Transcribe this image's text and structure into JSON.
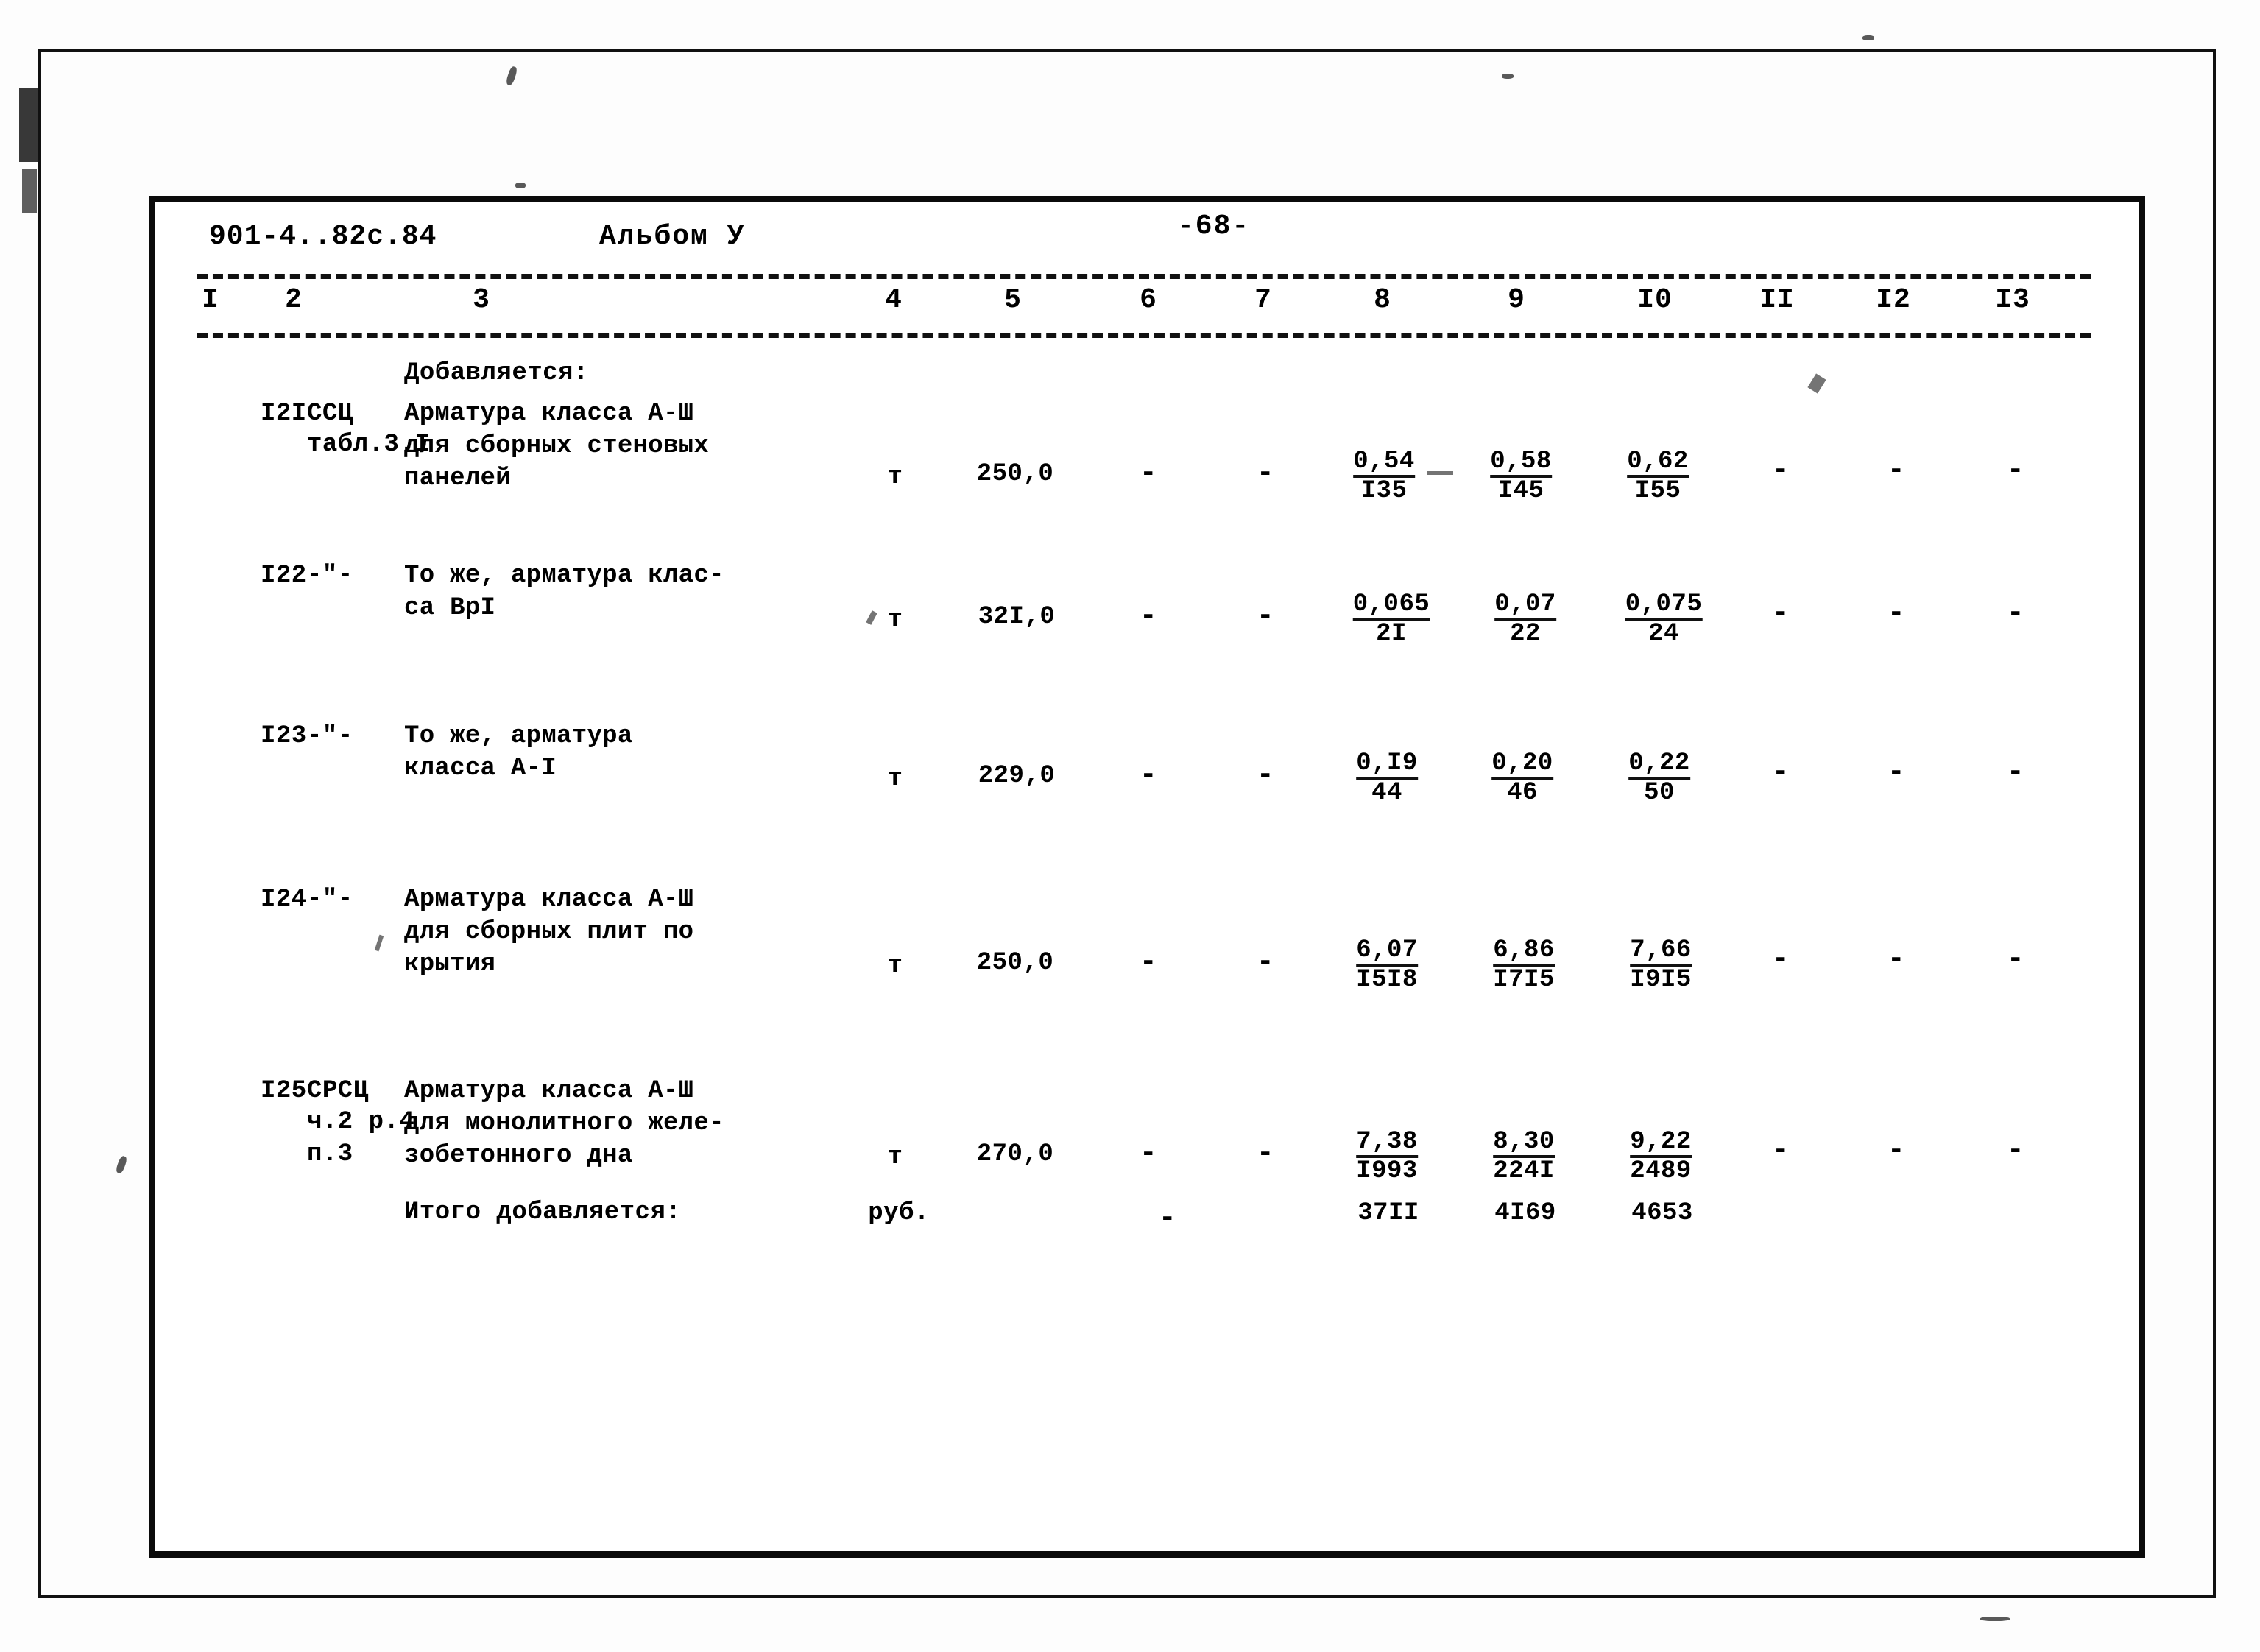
{
  "document": {
    "code": "901-4..82с.84",
    "album": "Альбом У",
    "page_number": "-68-"
  },
  "table": {
    "column_numbers": [
      "I",
      "2",
      "3",
      "4",
      "5",
      "6",
      "7",
      "8",
      "9",
      "I0",
      "II",
      "I2",
      "I3"
    ],
    "section_note": "Добавляется:",
    "rows": [
      {
        "num": "I2I",
        "ref": "ССЦ",
        "ref2": "табл.3.I",
        "desc": "Арматура класса А-Ш\nдля сборных стеновых\nпанелей",
        "unit": "т",
        "qty": "250,0",
        "c6": "-",
        "c7": "-",
        "c8_num": "0,54",
        "c8_den": "I35",
        "c9_num": "0,58",
        "c9_den": "I45",
        "c10_num": "0,62",
        "c10_den": "I55",
        "c11": "-",
        "c12": "-",
        "c13": "-"
      },
      {
        "num": "I22",
        "ref": "-\"-",
        "ref2": "",
        "desc": "То же, арматура клас-\nса ВрI",
        "unit": "т",
        "qty": "32I,0",
        "c6": "-",
        "c7": "-",
        "c8_num": "0,065",
        "c8_den": "2I",
        "c9_num": "0,07",
        "c9_den": "22",
        "c10_num": "0,075",
        "c10_den": "24",
        "c11": "-",
        "c12": "-",
        "c13": "-"
      },
      {
        "num": "I23",
        "ref": "-\"-",
        "ref2": "",
        "desc": "То же, арматура\nкласса А-I",
        "unit": "т",
        "qty": "229,0",
        "c6": "-",
        "c7": "-",
        "c8_num": "0,I9",
        "c8_den": "44",
        "c9_num": "0,20",
        "c9_den": "46",
        "c10_num": "0,22",
        "c10_den": "50",
        "c11": "-",
        "c12": "-",
        "c13": "-"
      },
      {
        "num": "I24",
        "ref": "-\"-",
        "ref2": "",
        "desc": "Арматура класса А-Ш\nдля сборных плит по\nкрытия",
        "unit": "т",
        "qty": "250,0",
        "c6": "-",
        "c7": "-",
        "c8_num": "6,07",
        "c8_den": "I5I8",
        "c9_num": "6,86",
        "c9_den": "I7I5",
        "c10_num": "7,66",
        "c10_den": "I9I5",
        "c11": "-",
        "c12": "-",
        "c13": "-"
      },
      {
        "num": "I25",
        "ref": "СРСЦ",
        "ref2": "ч.2 р.4\nп.3",
        "desc": "Арматура класса А-Ш\nдля монолитного желе-\nзобетонного дна",
        "unit": "т",
        "qty": "270,0",
        "c6": "-",
        "c7": "-",
        "c8_num": "7,38",
        "c8_den": "I993",
        "c9_num": "8,30",
        "c9_den": "224I",
        "c10_num": "9,22",
        "c10_den": "2489",
        "c11": "-",
        "c12": "-",
        "c13": "-"
      }
    ],
    "total": {
      "label": "Итого добавляется:",
      "unit": "руб.",
      "c7": "-",
      "c8": "37II",
      "c9": "4I69",
      "c10": "4653"
    }
  }
}
